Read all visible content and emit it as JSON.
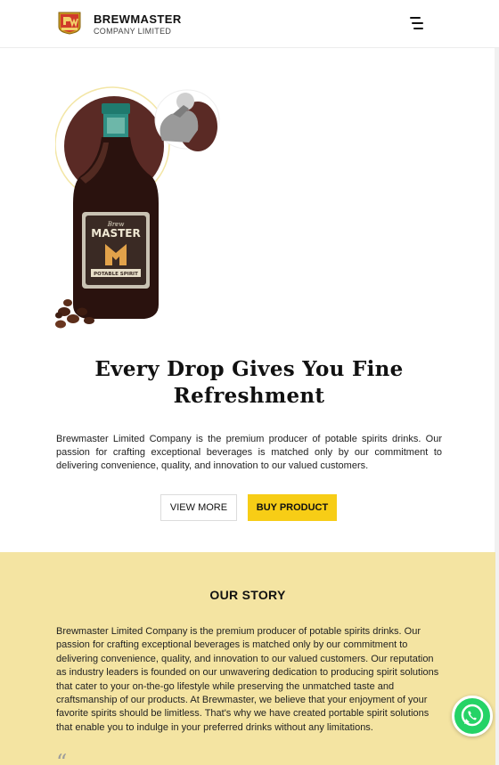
{
  "header": {
    "brand_name": "BREWMASTER",
    "brand_sub": "COMPANY LIMITED",
    "logo_icon": "brewmaster-logo",
    "menu_icon": "hamburger-menu-icon"
  },
  "hero": {
    "product_label_top": "Brew",
    "product_label_main": "MASTER",
    "product_label_sub": "POTABLE SPIRIT",
    "headline": "Every Drop Gives You Fine Refreshment",
    "intro": "Brewmaster Limited Company is the premium producer of potable spirits drinks. Our passion for crafting exceptional beverages is matched only by our commitment to delivering convenience, quality, and innovation to our valued customers.",
    "view_more_label": "VIEW MORE",
    "buy_label": "BUY PRODUCT"
  },
  "story": {
    "title": "OUR STORY",
    "text": "Brewmaster Limited Company is the premium producer of potable spirits drinks. Our passion for crafting exceptional beverages is matched only by our commitment to delivering convenience, quality, and innovation to our valued customers. Our reputation as industry leaders is founded on our unwavering dedication to producing spirit solutions that cater to your on-the-go lifestyle while preserving the unmatched taste and craftsmanship of our products. At Brewmaster, we believe that your enjoyment of your favorite spirits should be limitless. That's why we have created portable spirit solutions that enable you to indulge in your preferred drinks without any limitations.",
    "quote_glyph": "“"
  },
  "whatsapp": {
    "icon": "whatsapp-icon"
  },
  "colors": {
    "accent_yellow": "#f7cd16",
    "story_bg": "#f4e4a2",
    "whatsapp_green": "#25d366",
    "brown": "#5a2a25"
  }
}
